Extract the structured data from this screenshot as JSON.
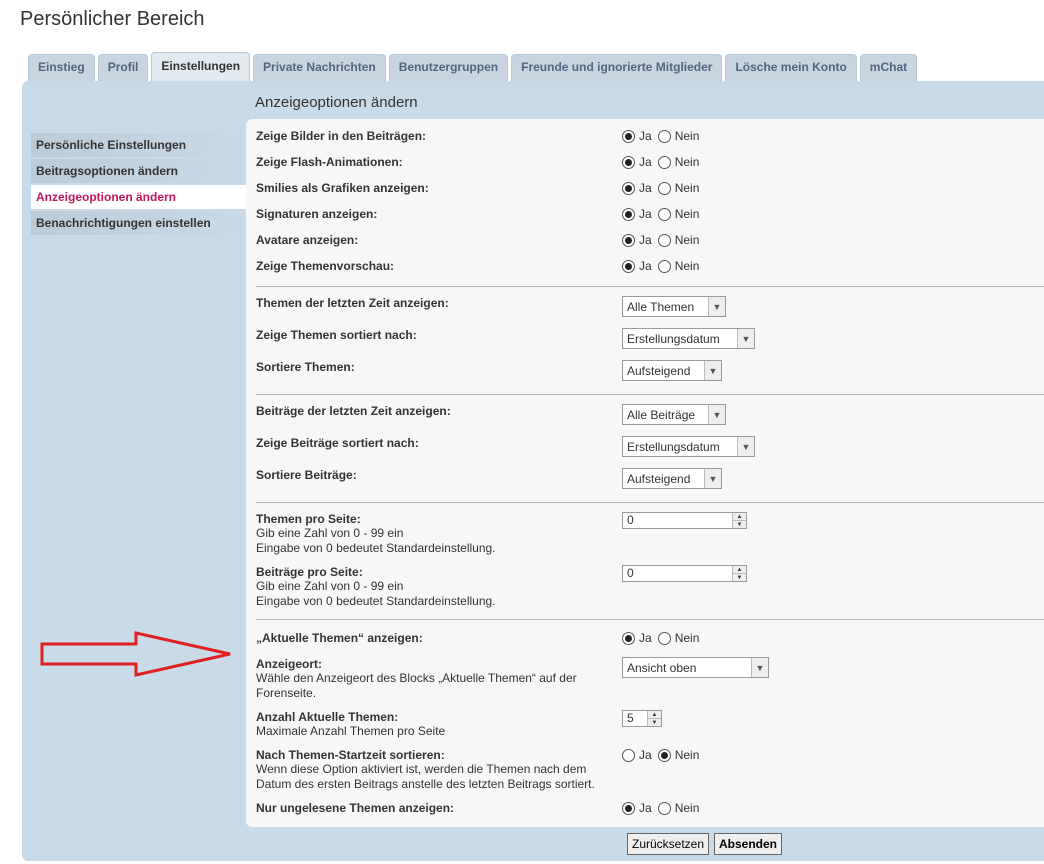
{
  "page": {
    "title": "Persönlicher Bereich"
  },
  "tabs": [
    {
      "label": "Einstieg",
      "active": false
    },
    {
      "label": "Profil",
      "active": false
    },
    {
      "label": "Einstellungen",
      "active": true
    },
    {
      "label": "Private Nachrichten",
      "active": false
    },
    {
      "label": "Benutzergruppen",
      "active": false
    },
    {
      "label": "Freunde und ignorierte Mitglieder",
      "active": false
    },
    {
      "label": "Lösche mein Konto",
      "active": false
    },
    {
      "label": "mChat",
      "active": false
    }
  ],
  "section_title": "Anzeigeoptionen ändern",
  "sidebar": {
    "items": [
      {
        "label": "Persönliche Einstellungen"
      },
      {
        "label": "Beitragsoptionen ändern"
      },
      {
        "label": "Anzeigeoptionen ändern"
      },
      {
        "label": "Benachrichtigungen einstellen"
      }
    ]
  },
  "options": {
    "yes": "Ja",
    "no": "Nein",
    "images": {
      "label": "Zeige Bilder in den Beiträgen:",
      "value": "Ja"
    },
    "flash": {
      "label": "Zeige Flash-Animationen:",
      "value": "Ja"
    },
    "smilies": {
      "label": "Smilies als Grafiken anzeigen:",
      "value": "Ja"
    },
    "signatures": {
      "label": "Signaturen anzeigen:",
      "value": "Ja"
    },
    "avatars": {
      "label": "Avatare anzeigen:",
      "value": "Ja"
    },
    "preview": {
      "label": "Zeige Themenvorschau:",
      "value": "Ja"
    },
    "topics_recent": {
      "label": "Themen der letzten Zeit anzeigen:",
      "value": "Alle Themen"
    },
    "topics_sort": {
      "label": "Zeige Themen sortiert nach:",
      "value": "Erstellungsdatum"
    },
    "topics_order": {
      "label": "Sortiere Themen:",
      "value": "Aufsteigend"
    },
    "posts_recent": {
      "label": "Beiträge der letzten Zeit anzeigen:",
      "value": "Alle Beiträge"
    },
    "posts_sort": {
      "label": "Zeige Beiträge sortiert nach:",
      "value": "Erstellungsdatum"
    },
    "posts_order": {
      "label": "Sortiere Beiträge:",
      "value": "Aufsteigend"
    },
    "topics_per_page": {
      "label": "Themen pro Seite:",
      "desc1": "Gib eine Zahl von 0 - 99 ein",
      "desc2": "Eingabe von 0 bedeutet Standardeinstellung.",
      "value": "0"
    },
    "posts_per_page": {
      "label": "Beiträge pro Seite:",
      "desc1": "Gib eine Zahl von 0 - 99 ein",
      "desc2": "Eingabe von 0 bedeutet Standardeinstellung.",
      "value": "0"
    },
    "recent_topics_show": {
      "label": "„Aktuelle Themen“ anzeigen:",
      "value": "Ja"
    },
    "display_location": {
      "label": "Anzeigeort:",
      "desc1": "Wähle den Anzeigeort des Blocks „Aktuelle Themen“ auf der",
      "desc2": "Forenseite.",
      "value": "Ansicht oben"
    },
    "recent_count": {
      "label": "Anzahl Aktuelle Themen:",
      "desc1": "Maximale Anzahl Themen pro Seite",
      "value": "5"
    },
    "sort_by_start": {
      "label": "Nach Themen-Startzeit sortieren:",
      "desc1": "Wenn diese Option aktiviert ist, werden die Themen nach dem",
      "desc2": "Datum des ersten Beitrags anstelle des letzten Beitrags sortiert.",
      "value": "Nein"
    },
    "unread_only": {
      "label": "Nur ungelesene Themen anzeigen:",
      "value": "Ja"
    }
  },
  "buttons": {
    "reset": "Zurücksetzen",
    "submit": "Absenden"
  },
  "colors": {
    "active_sidebar": "#c2185b",
    "panel": "#c9dae8",
    "annotation_arrow": "#e02020"
  }
}
